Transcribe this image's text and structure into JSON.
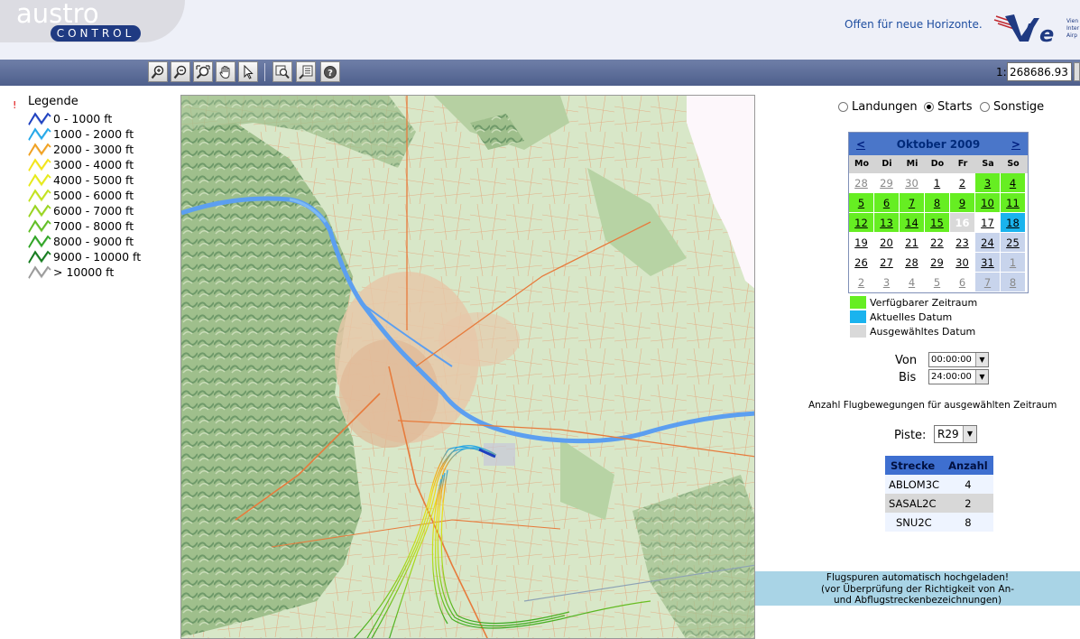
{
  "header": {
    "logo_top": "austro",
    "logo_bottom": "CONTROL",
    "slogan": "Offen für neue Horizonte.",
    "airport_logo": "VIE",
    "airport_logo_subtext": [
      "Vien",
      "Inter",
      "Airp"
    ]
  },
  "toolbar": {
    "tools": [
      {
        "icon": "zoom-in-icon"
      },
      {
        "icon": "zoom-out-icon"
      },
      {
        "icon": "zoom-extent-icon"
      },
      {
        "icon": "pan-hand-icon"
      },
      {
        "icon": "select-arrow-icon"
      },
      {
        "icon": "zoom-window-icon"
      },
      {
        "icon": "identify-icon"
      },
      {
        "icon": "help-icon"
      }
    ],
    "scale_prefix": "1:",
    "scale_value": "268686.93"
  },
  "legend": {
    "marker": "!",
    "title": "Legende",
    "items": [
      {
        "label": "0 - 1000 ft",
        "color": "#1c3fbf"
      },
      {
        "label": "1000 - 2000 ft",
        "color": "#22a7e8"
      },
      {
        "label": "2000 - 3000 ft",
        "color": "#f0a020"
      },
      {
        "label": "3000 - 4000 ft",
        "color": "#f2e418"
      },
      {
        "label": "4000 - 5000 ft",
        "color": "#e6ea18"
      },
      {
        "label": "5000 - 6000 ft",
        "color": "#c2e21c"
      },
      {
        "label": "6000 - 7000 ft",
        "color": "#98d41e"
      },
      {
        "label": "7000 - 8000 ft",
        "color": "#5fbe22"
      },
      {
        "label": "8000 - 9000 ft",
        "color": "#2ea424"
      },
      {
        "label": "9000 - 10000 ft",
        "color": "#137a1c"
      },
      {
        "label": "> 10000 ft",
        "color": "#9a9a9a"
      }
    ]
  },
  "filter": {
    "options": [
      {
        "label": "Landungen",
        "selected": false
      },
      {
        "label": "Starts",
        "selected": true
      },
      {
        "label": "Sonstige",
        "selected": false
      }
    ]
  },
  "calendar": {
    "prev": "<",
    "title": "Oktober 2009",
    "next": ">",
    "weekdays": [
      "Mo",
      "Di",
      "Mi",
      "Do",
      "Fr",
      "Sa",
      "So"
    ],
    "weeks": [
      [
        {
          "d": "28",
          "s": "other"
        },
        {
          "d": "29",
          "s": "other"
        },
        {
          "d": "30",
          "s": "other"
        },
        {
          "d": "1",
          "s": "norm"
        },
        {
          "d": "2",
          "s": "norm"
        },
        {
          "d": "3",
          "s": "avail"
        },
        {
          "d": "4",
          "s": "avail"
        }
      ],
      [
        {
          "d": "5",
          "s": "avail"
        },
        {
          "d": "6",
          "s": "avail"
        },
        {
          "d": "7",
          "s": "avail"
        },
        {
          "d": "8",
          "s": "avail"
        },
        {
          "d": "9",
          "s": "avail"
        },
        {
          "d": "10",
          "s": "avail"
        },
        {
          "d": "11",
          "s": "avail"
        }
      ],
      [
        {
          "d": "12",
          "s": "avail"
        },
        {
          "d": "13",
          "s": "avail"
        },
        {
          "d": "14",
          "s": "avail"
        },
        {
          "d": "15",
          "s": "avail"
        },
        {
          "d": "16",
          "s": "sel"
        },
        {
          "d": "17",
          "s": "norm"
        },
        {
          "d": "18",
          "s": "today"
        }
      ],
      [
        {
          "d": "19",
          "s": "norm"
        },
        {
          "d": "20",
          "s": "norm"
        },
        {
          "d": "21",
          "s": "norm"
        },
        {
          "d": "22",
          "s": "norm"
        },
        {
          "d": "23",
          "s": "norm"
        },
        {
          "d": "24",
          "s": "weekend"
        },
        {
          "d": "25",
          "s": "weekend"
        }
      ],
      [
        {
          "d": "26",
          "s": "norm"
        },
        {
          "d": "27",
          "s": "norm"
        },
        {
          "d": "28",
          "s": "norm"
        },
        {
          "d": "29",
          "s": "norm"
        },
        {
          "d": "30",
          "s": "norm"
        },
        {
          "d": "31",
          "s": "weekend"
        },
        {
          "d": "1",
          "s": "other-weekend"
        }
      ],
      [
        {
          "d": "2",
          "s": "other"
        },
        {
          "d": "3",
          "s": "other"
        },
        {
          "d": "4",
          "s": "other"
        },
        {
          "d": "5",
          "s": "other"
        },
        {
          "d": "6",
          "s": "other"
        },
        {
          "d": "7",
          "s": "other-weekend"
        },
        {
          "d": "8",
          "s": "other-weekend"
        }
      ]
    ],
    "legend": [
      {
        "label": "Verfügbarer Zeitraum",
        "color": "#66ee22"
      },
      {
        "label": "Aktuelles Datum",
        "color": "#1ab3ee"
      },
      {
        "label": "Ausgewähltes Datum",
        "color": "#d9d9d9"
      }
    ]
  },
  "time": {
    "from_label": "Von",
    "from_value": "00:00:00",
    "to_label": "Bis",
    "to_value": "24:00:00"
  },
  "count_text": "Anzahl Flugbewegungen für ausgewählten Zeitraum",
  "piste": {
    "label": "Piste:",
    "value": "R29"
  },
  "routes": {
    "headers": [
      "Strecke",
      "Anzahl"
    ],
    "rows": [
      {
        "name": "ABLOM3C",
        "count": "4"
      },
      {
        "name": "SASAL2C",
        "count": "2"
      },
      {
        "name": "SNU2C",
        "count": "8"
      }
    ]
  },
  "notice": {
    "line1": "Flugspuren automatisch hochgeladen!",
    "line2": "(vor Überprüfung der Richtigkeit von An-",
    "line3": "und Abflugstreckenbezeichnungen)"
  },
  "colors": {
    "toolbar": "#5a6a96",
    "brand_blue": "#1f3a82",
    "calendar_header": "#4a76c9",
    "notice_bg": "#a9d4e6"
  }
}
